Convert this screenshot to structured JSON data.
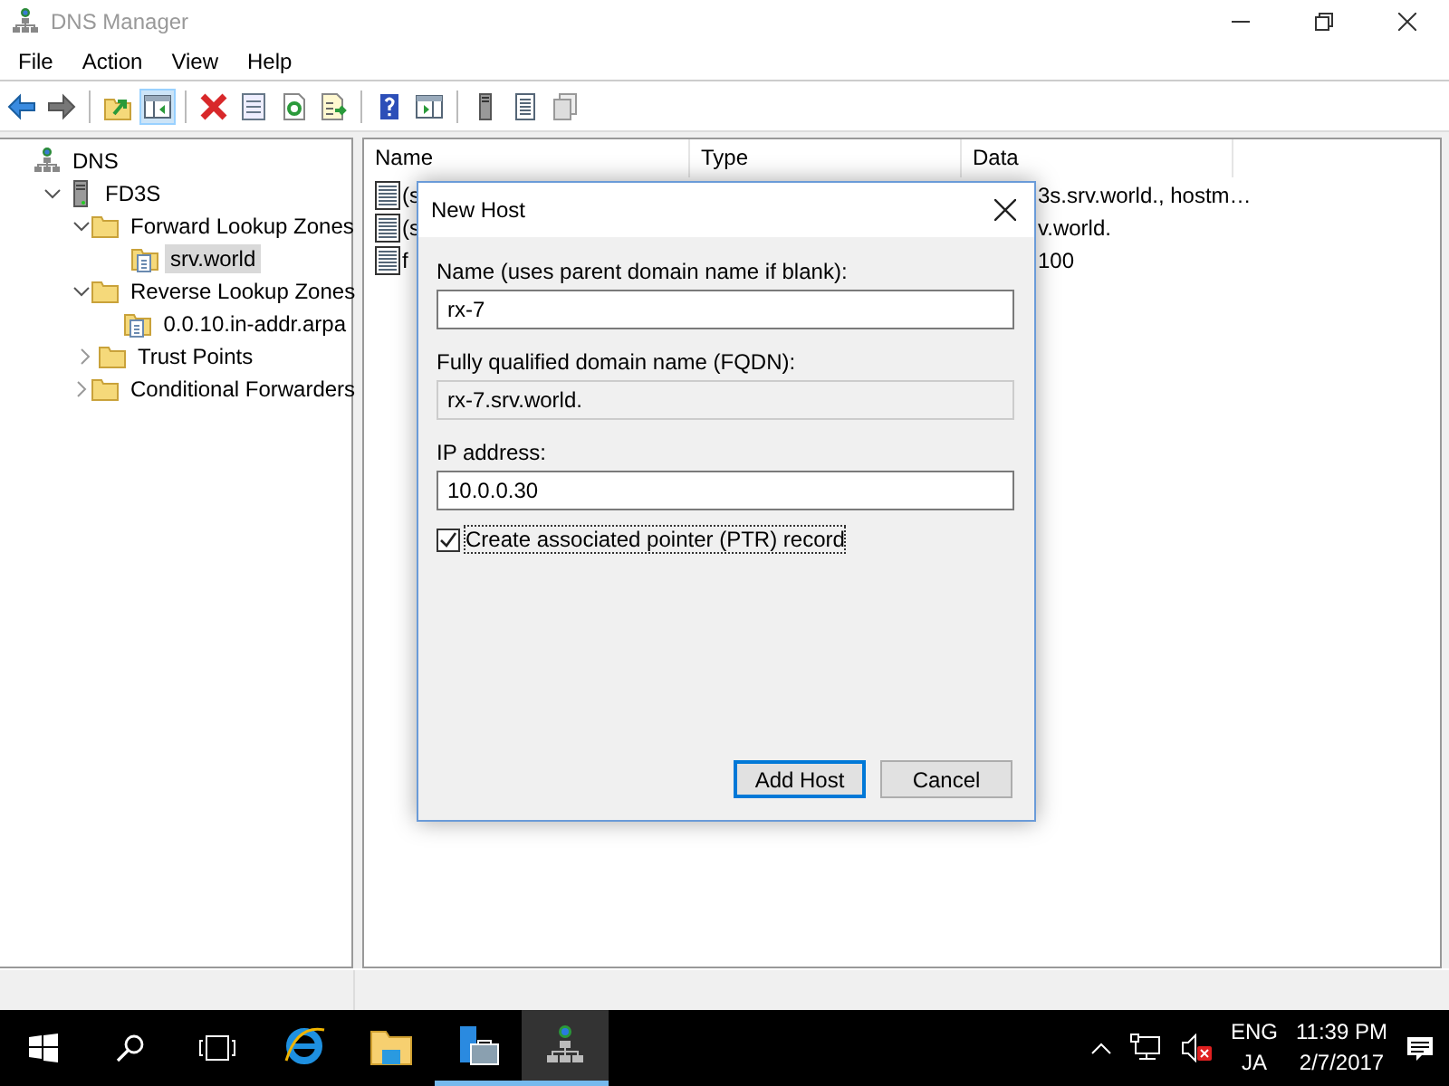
{
  "window": {
    "title": "DNS Manager"
  },
  "menu": [
    "File",
    "Action",
    "View",
    "Help"
  ],
  "toolbar": [
    {
      "kind": "back",
      "pressed": false
    },
    {
      "kind": "forward",
      "pressed": false
    },
    {
      "kind": "sep"
    },
    {
      "kind": "up",
      "pressed": false
    },
    {
      "kind": "pane",
      "pressed": true
    },
    {
      "kind": "sep"
    },
    {
      "kind": "delete",
      "pressed": false
    },
    {
      "kind": "properties",
      "pressed": false
    },
    {
      "kind": "refresh",
      "pressed": false
    },
    {
      "kind": "export",
      "pressed": false
    },
    {
      "kind": "sep"
    },
    {
      "kind": "help",
      "pressed": false
    },
    {
      "kind": "pane2",
      "pressed": false
    },
    {
      "kind": "sep"
    },
    {
      "kind": "server",
      "pressed": false
    },
    {
      "kind": "list",
      "pressed": false
    },
    {
      "kind": "copy",
      "pressed": false
    }
  ],
  "tree": [
    {
      "label": "DNS",
      "kind": "dns",
      "selected": false,
      "children": [
        {
          "label": "FD3S",
          "kind": "server",
          "selected": false,
          "expanded": true,
          "children": [
            {
              "label": "Forward Lookup Zones",
              "kind": "folder",
              "selected": false,
              "expanded": true,
              "children": [
                {
                  "label": "srv.world",
                  "kind": "zone",
                  "selected": true
                }
              ]
            },
            {
              "label": "Reverse Lookup Zones",
              "kind": "folder",
              "selected": false,
              "expanded": true,
              "children": [
                {
                  "label": "0.0.10.in-addr.arpa",
                  "kind": "zone",
                  "selected": false
                }
              ]
            },
            {
              "label": "Trust Points",
              "kind": "folder",
              "selected": false,
              "expanded": false
            },
            {
              "label": "Conditional Forwarders",
              "kind": "folder",
              "selected": false,
              "expanded": false
            }
          ]
        }
      ]
    }
  ],
  "list": {
    "columns": [
      "Name",
      "Type",
      "Data"
    ],
    "rows": [
      {
        "name": "(s",
        "data": "3s.srv.world., hostm…"
      },
      {
        "name": "(s",
        "data": "v.world."
      },
      {
        "name": "f",
        "data": "100"
      }
    ]
  },
  "dialog": {
    "title": "New Host",
    "fields": [
      {
        "label": "Name (uses parent domain name if blank):",
        "value": "rx-7",
        "disabled": false
      },
      {
        "label": "Fully qualified domain name (FQDN):",
        "value": "rx-7.srv.world.",
        "disabled": true
      },
      {
        "label": "IP address:",
        "value": "10.0.0.30",
        "disabled": false
      }
    ],
    "checkbox": {
      "label": "Create associated pointer (PTR) record",
      "checked": true
    },
    "buttons": [
      {
        "label": "Add Host",
        "default": true
      },
      {
        "label": "Cancel",
        "default": false
      }
    ]
  },
  "taskbar": {
    "apps": [
      {
        "kind": "ie",
        "active": false,
        "running": false
      },
      {
        "kind": "explorer",
        "active": false,
        "running": false
      },
      {
        "kind": "servermanager",
        "active": false,
        "running": true
      },
      {
        "kind": "dns",
        "active": true,
        "running": true
      }
    ],
    "language": "ENG",
    "layout": "JA",
    "time": "11:39 PM",
    "date": "2/7/2017"
  }
}
